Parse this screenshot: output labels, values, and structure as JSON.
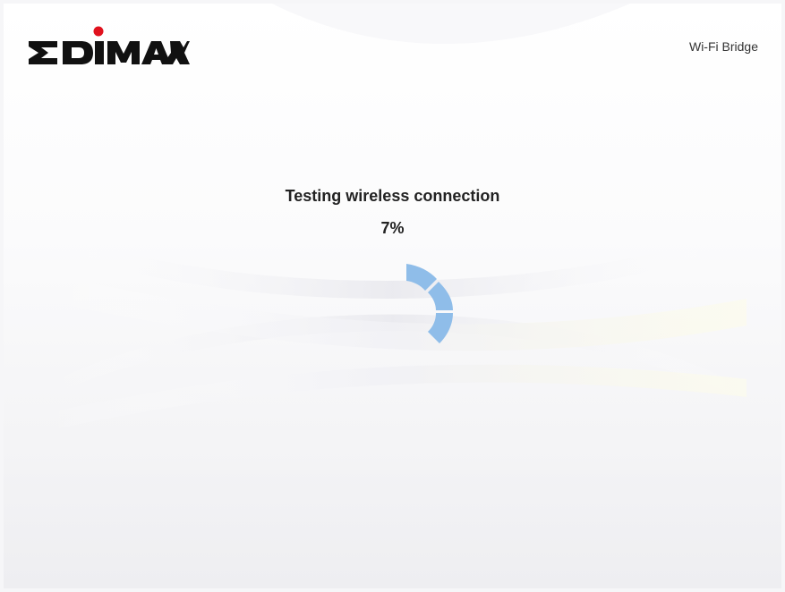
{
  "header": {
    "brand": "EDIMAX",
    "product": "Wi-Fi Bridge"
  },
  "status": {
    "title": "Testing wireless connection",
    "percent_label": "7%",
    "progress": 0.07
  },
  "colors": {
    "spinner": "#8fbde9",
    "logo_text": "#111111",
    "logo_dot": "#e0111d",
    "text": "#222222"
  },
  "icons": {
    "spinner": "loading-spinner-icon",
    "logo": "edimax-logo"
  }
}
